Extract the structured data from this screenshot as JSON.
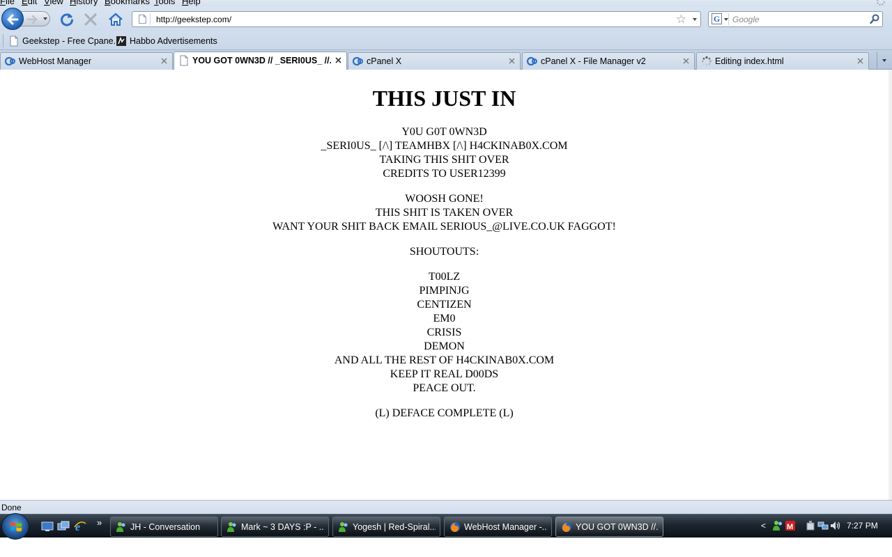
{
  "menu": [
    {
      "label": "File",
      "accel": "F",
      "rest": "ile"
    },
    {
      "label": "Edit",
      "accel": "E",
      "rest": "dit"
    },
    {
      "label": "View",
      "accel": "V",
      "rest": "iew"
    },
    {
      "label": "History",
      "accel": "H",
      "rest": "istory"
    },
    {
      "label": "Bookmarks",
      "accel": "B",
      "rest": "ookmarks"
    },
    {
      "label": "Tools",
      "accel": "T",
      "rest": "ools"
    },
    {
      "label": "Help",
      "accel": "H",
      "rest": "elp"
    }
  ],
  "nav": {
    "url": "http://geekstep.com/",
    "search_placeholder": "Google"
  },
  "bookmarks": [
    {
      "label": "Geekstep - Free Cpane...",
      "icon": "page-icon"
    },
    {
      "label": "Habbo Advertisements",
      "icon": "habbo-icon"
    }
  ],
  "tabs": [
    {
      "label": "WebHost Manager",
      "icon": "cpanel-icon",
      "active": false
    },
    {
      "label": "YOU GOT 0WN3D // _SERI0US_ //...",
      "icon": "page-icon",
      "active": true
    },
    {
      "label": "cPanel X",
      "icon": "cpanel-icon",
      "active": false
    },
    {
      "label": "cPanel X - File Manager v2",
      "icon": "cpanel-icon",
      "active": false
    },
    {
      "label": "Editing index.html",
      "icon": "loading-icon",
      "active": false
    }
  ],
  "page": {
    "title": "THIS JUST IN",
    "block1": [
      "Y0U G0T 0WN3D",
      "_SERI0US_ [/\\] TEAMHBX [/\\] H4CKINAB0X.COM",
      "TAKING THIS SHIT OVER",
      "CREDITS TO USER12399"
    ],
    "block2": [
      "WOOSH GONE!",
      "THIS SHIT IS TAKEN OVER",
      "WANT YOUR SHIT BACK EMAIL SERIOUS_@LIVE.CO.UK FAGGOT!"
    ],
    "block3": [
      "SHOUTOUTS:"
    ],
    "block4": [
      "T00LZ",
      "PIMPINJG",
      "CENTIZEN",
      "EM0",
      "CRISIS",
      "DEMON",
      "AND ALL THE REST OF H4CKINAB0X.COM",
      "KEEP IT REAL D00DS",
      "PEACE OUT."
    ],
    "block5": [
      "(L) DEFACE COMPLETE (L)"
    ]
  },
  "status": "Done",
  "taskbar": {
    "tasks": [
      {
        "label": "JH - Conversation",
        "icon": "messenger-icon",
        "active": false
      },
      {
        "label": "Mark ~ 3 DAYS :P - ...",
        "icon": "messenger-icon",
        "active": false
      },
      {
        "label": "Yogesh | Red-Spiral...",
        "icon": "messenger-icon",
        "active": false
      },
      {
        "label": "WebHost Manager -...",
        "icon": "firefox-icon",
        "active": false
      },
      {
        "label": "YOU GOT 0WN3D //...",
        "icon": "firefox-icon",
        "active": true
      }
    ],
    "clock": "7:27 PM"
  },
  "colors": {
    "toolbar": "#d5e0ee",
    "tabstrip": "#b8c9de",
    "taskbar": "#1c252f",
    "link_blue": "#1d5fb5"
  }
}
